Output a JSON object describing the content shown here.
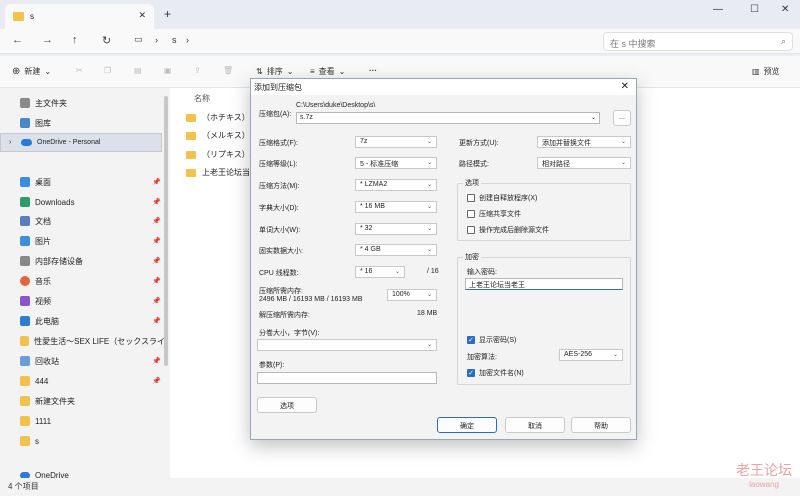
{
  "tab": {
    "title": "s",
    "close": "✕",
    "new": "+"
  },
  "window": {
    "min": "—",
    "max": "☐",
    "close": "✕"
  },
  "address": {
    "path1": "s",
    "search_placeholder": "在 s 中搜索"
  },
  "toolbar": {
    "new": "新建",
    "sort": "排序",
    "view": "查看",
    "more": "···",
    "preview": "预览"
  },
  "sidebar": {
    "items": [
      {
        "label": "主文件夹"
      },
      {
        "label": "图库"
      },
      {
        "label": "OneDrive - Personal"
      },
      {
        "label": "桌面"
      },
      {
        "label": "Downloads"
      },
      {
        "label": "文档"
      },
      {
        "label": "图片"
      },
      {
        "label": "内部存储设备"
      },
      {
        "label": "音乐"
      },
      {
        "label": "视频"
      },
      {
        "label": "此电脑"
      },
      {
        "label": "性愛生活～SEX LIFE（セックスライ"
      },
      {
        "label": "回收站"
      },
      {
        "label": "444"
      },
      {
        "label": "新建文件夹"
      },
      {
        "label": "1111"
      },
      {
        "label": "s"
      },
      {
        "label": "OneDrive"
      }
    ]
  },
  "content": {
    "col_name": "名称",
    "files": [
      "（ホチキス）A",
      "（メルキス）A",
      "（リプキス）A",
      "上老王论坛当老"
    ]
  },
  "status": {
    "count": "4 个项目"
  },
  "watermark": {
    "line1": "老王论坛",
    "line2": "laowang"
  },
  "dialog": {
    "title": "添加到压缩包",
    "archive_label": "压缩包(A):",
    "archive_dir": "C:\\Users\\duke\\Desktop\\s\\",
    "archive_name": "s.7z",
    "browse": "...",
    "format_label": "压缩格式(F):",
    "format": "7z",
    "level_label": "压缩等级(L):",
    "level": "5 - 标准压缩",
    "method_label": "压缩方法(M):",
    "method": "* LZMA2",
    "dict_label": "字典大小(D):",
    "dict": "* 16 MB",
    "word_label": "单词大小(W):",
    "word": "* 32",
    "solid_label": "固实数据大小:",
    "solid": "* 4 GB",
    "cpu_label": "CPU 线程数:",
    "cpu": "* 16",
    "cpu_total": "/ 16",
    "mem_label": "压缩所需内存:",
    "mem_value": "2496 MB / 16193 MB / 16193 MB",
    "mem_pct": "100%",
    "dmem_label": "解压缩所需内存:",
    "dmem_value": "18 MB",
    "split_label": "分卷大小，字节(V):",
    "params_label": "参数(P):",
    "options_btn": "选项",
    "update_label": "更新方式(U):",
    "update": "添加并替换文件",
    "pathmode_label": "路径模式:",
    "pathmode": "相对路径",
    "opts_group": "选项",
    "opt1": "创建自释放程序(X)",
    "opt2": "压缩共享文件",
    "opt3": "操作完成后删除源文件",
    "enc_group": "加密",
    "pwd_label": "输入密码:",
    "pwd_value": "上老王论坛当老王",
    "show_pwd": "显示密码(S)",
    "enc_method_label": "加密算法:",
    "enc_method": "AES-256",
    "enc_names": "加密文件名(N)",
    "ok": "确定",
    "cancel": "取消",
    "help": "帮助"
  },
  "colors": {
    "folder": "#f2c24c",
    "accent": "#2b6cc4"
  }
}
